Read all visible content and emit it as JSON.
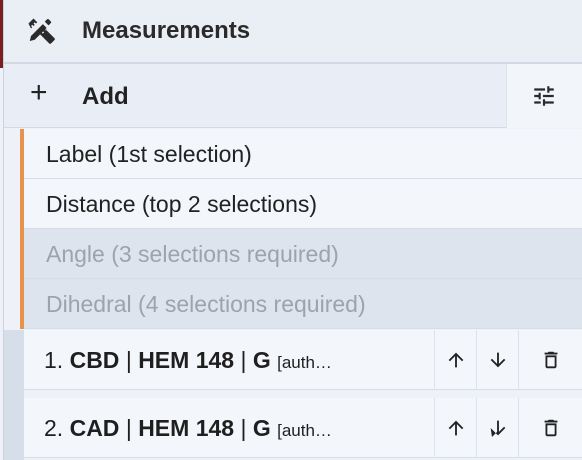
{
  "panel": {
    "title": "Measurements",
    "title_icon": "ruler-pencil-icon"
  },
  "toolbar": {
    "add_symbol": "+",
    "add_label": "Add",
    "settings_icon": "sliders-icon"
  },
  "add_menu": {
    "items": [
      {
        "label": "Label (1st selection)",
        "enabled": true
      },
      {
        "label": "Distance (top 2 selections)",
        "enabled": true
      },
      {
        "label": "Angle (3 selections required)",
        "enabled": false
      },
      {
        "label": "Dihedral (4 selections required)",
        "enabled": false
      }
    ]
  },
  "measurements": [
    {
      "index": "1.",
      "atom": "CBD",
      "residue": "HEM 148",
      "chain": "G",
      "extra": "[auth…"
    },
    {
      "index": "2.",
      "atom": "CAD",
      "residue": "HEM 148",
      "chain": "G",
      "extra": "[auth…"
    }
  ],
  "separator": "|",
  "colors": {
    "menu_accent": "#e8934b",
    "panel_bg": "#eef2f8",
    "disabled_text": "#9aa3af"
  }
}
